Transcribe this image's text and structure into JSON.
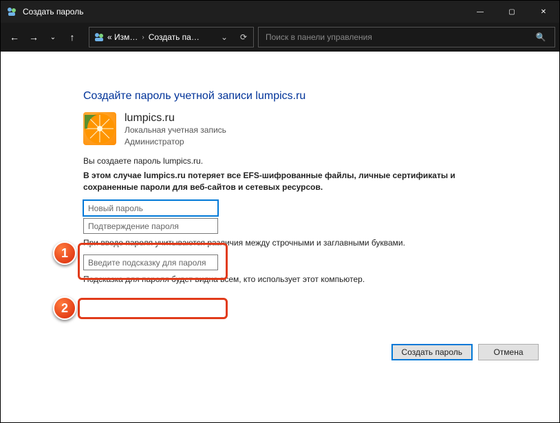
{
  "window": {
    "title": "Создать пароль"
  },
  "nav": {
    "crumb1": "« Изм…",
    "crumb2": "Создать па…",
    "search_placeholder": "Поиск в панели управления"
  },
  "page": {
    "heading": "Создайте пароль учетной записи lumpics.ru",
    "account_name": "lumpics.ru",
    "account_type": "Локальная учетная запись",
    "account_role": "Администратор",
    "creating_for": "Вы создаете пароль lumpics.ru.",
    "warning": "В этом случае lumpics.ru потеряет все EFS-шифрованные файлы, личные сертификаты и сохраненные пароли для веб-сайтов и сетевых ресурсов.",
    "new_password_ph": "Новый пароль",
    "confirm_password_ph": "Подтверждение пароля",
    "case_note": "При вводе пароля учитываются различия между строчными и заглавными буквами.",
    "hint_ph": "Введите подсказку для пароля",
    "hint_note": "Подсказка для пароля будет видна всем, кто использует этот компьютер.",
    "btn_create": "Создать пароль",
    "btn_cancel": "Отмена"
  },
  "badges": {
    "one": "1",
    "two": "2"
  }
}
